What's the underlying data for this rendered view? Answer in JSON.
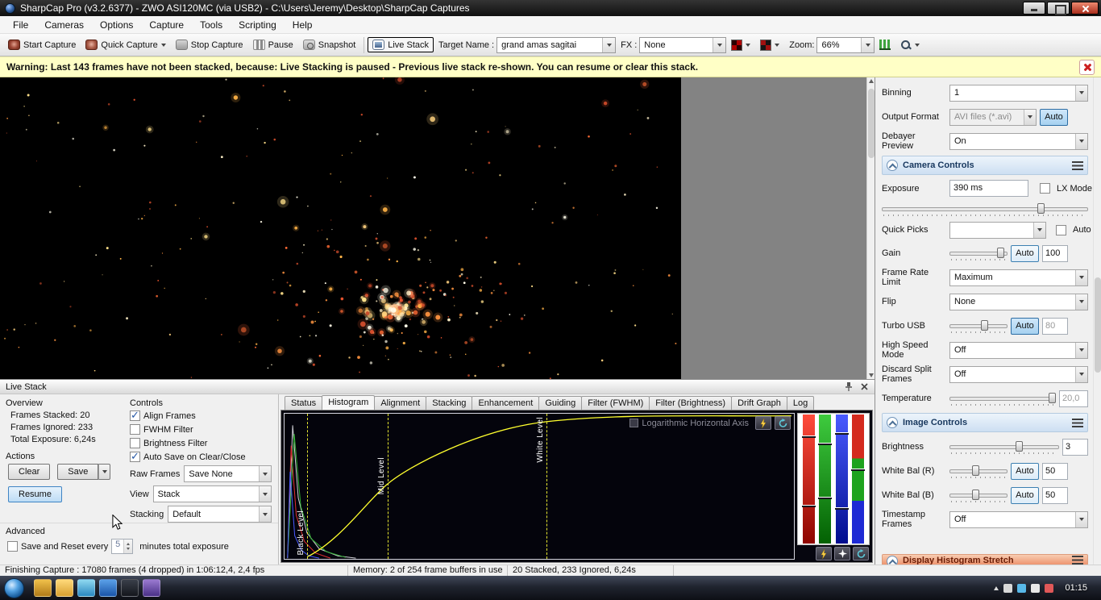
{
  "window": {
    "title": "SharpCap Pro (v3.2.6377) - ZWO ASI120MC (via USB2) - C:\\Users\\Jeremy\\Desktop\\SharpCap Captures"
  },
  "menu": {
    "items": [
      "File",
      "Cameras",
      "Options",
      "Capture",
      "Tools",
      "Scripting",
      "Help"
    ]
  },
  "toolbar": {
    "start_capture": "Start Capture",
    "quick_capture": "Quick Capture",
    "stop_capture": "Stop Capture",
    "pause": "Pause",
    "snapshot": "Snapshot",
    "live_stack": "Live Stack",
    "target_name_label": "Target Name :",
    "target_name_value": "grand amas sagitai",
    "fx_label": "FX :",
    "fx_value": "None",
    "zoom_label": "Zoom:",
    "zoom_value": "66%"
  },
  "warning": {
    "text": "Warning: Last 143 frames have not been stacked, because: Live Stacking is paused - Previous live stack re-shown. You can resume or clear this stack."
  },
  "image_view": {
    "starfield": {
      "background_count": 170,
      "cluster_count": 240,
      "cluster_x": 0.58,
      "cluster_y": 0.77,
      "cluster_radius": 155,
      "colors": [
        "#ffd27f",
        "#ffb347",
        "#ff9440",
        "#ff6b35",
        "#e8542f",
        "#fff1c9",
        "#ffe08a",
        "#c94a2a",
        "#fffbe8"
      ]
    }
  },
  "live_stack": {
    "title": "Live Stack",
    "overview": {
      "heading": "Overview",
      "frames_stacked": "Frames Stacked: 20",
      "frames_ignored": "Frames Ignored:  233",
      "total_exposure": "Total Exposure:  6,24s"
    },
    "actions": {
      "heading": "Actions",
      "clear": "Clear",
      "save": "Save",
      "resume": "Resume"
    },
    "controls": {
      "heading": "Controls",
      "checkboxes": [
        {
          "label": "Align Frames",
          "checked": true
        },
        {
          "label": "FWHM Filter",
          "checked": false
        },
        {
          "label": "Brightness Filter",
          "checked": false
        },
        {
          "label": "Auto Save on Clear/Close",
          "checked": true
        }
      ],
      "raw_frames_label": "Raw Frames",
      "raw_frames_value": "Save None",
      "view_label": "View",
      "view_value": "Stack",
      "stacking_label": "Stacking",
      "stacking_value": "Default"
    },
    "advanced": {
      "heading": "Advanced",
      "save_reset_label": "Save and Reset every",
      "minutes_value": "5",
      "minutes_suffix": "minutes total exposure"
    },
    "tabs": [
      "Status",
      "Histogram",
      "Alignment",
      "Stacking",
      "Enhancement",
      "Guiding",
      "Filter (FWHM)",
      "Filter (Brightness)",
      "Drift Graph",
      "Log"
    ],
    "active_tab": "Histogram"
  },
  "histogram": {
    "log_axis_label": "Logarithmic Horizontal Axis",
    "black_level_label": "Black Level",
    "mid_level_label": "Mid Level",
    "white_level_label": "White Level",
    "colors": {
      "curve": "#ffff2e",
      "bar_red": "#cc1111",
      "bar_green": "#11aa11",
      "bar_blue": "#2222dd"
    }
  },
  "right_panel": {
    "binning": {
      "label": "Binning",
      "value": "1"
    },
    "output_format": {
      "label": "Output Format",
      "value": "AVI files (*.avi)",
      "auto_label": "Auto"
    },
    "debayer_preview": {
      "label": "Debayer Preview",
      "value": "On"
    },
    "camera_controls_heading": "Camera Controls",
    "exposure": {
      "label": "Exposure",
      "value": "390 ms",
      "lx_mode_label": "LX Mode"
    },
    "quick_picks": {
      "label": "Quick Picks",
      "auto_label": "Auto"
    },
    "gain": {
      "label": "Gain",
      "auto_label": "Auto",
      "value": "100"
    },
    "frame_rate_limit": {
      "label": "Frame Rate Limit",
      "value": "Maximum"
    },
    "flip": {
      "label": "Flip",
      "value": "None"
    },
    "turbo_usb": {
      "label": "Turbo USB",
      "auto_label": "Auto",
      "value": "80"
    },
    "high_speed_mode": {
      "label": "High Speed Mode",
      "value": "Off"
    },
    "discard_split_frames": {
      "label": "Discard Split Frames",
      "value": "Off"
    },
    "temperature": {
      "label": "Temperature",
      "value": "20,0"
    },
    "image_controls_heading": "Image Controls",
    "brightness": {
      "label": "Brightness",
      "value": "3"
    },
    "white_bal_r": {
      "label": "White Bal (R)",
      "auto_label": "Auto",
      "value": "50"
    },
    "white_bal_b": {
      "label": "White Bal (B)",
      "auto_label": "Auto",
      "value": "50"
    },
    "timestamp_frames": {
      "label": "Timestamp Frames",
      "value": "Off"
    },
    "display_stretch_heading": "Display Histogram Stretch"
  },
  "status_bar": {
    "capture": "Finishing Capture : 17080 frames (4 dropped) in 1:06:12,4, 2,4 fps",
    "memory": "Memory: 2 of 254 frame buffers in use",
    "stacked": "20 Stacked, 233 Ignored, 6,24s"
  },
  "taskbar": {
    "clock": "01:15"
  }
}
